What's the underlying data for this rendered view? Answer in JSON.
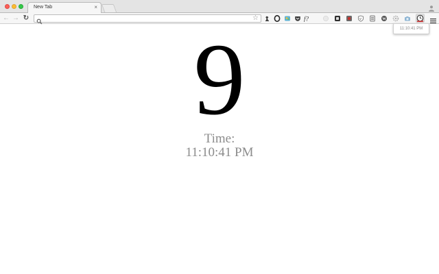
{
  "browser": {
    "tab": {
      "title": "New Tab",
      "close_glyph": "×"
    },
    "toolbar": {
      "back_icon": "arrow-left-icon",
      "forward_icon": "arrow-right-icon",
      "reload_icon": "reload-icon",
      "omnibox": {
        "value": "",
        "placeholder": "",
        "search_icon": "search-icon",
        "bookmark_icon": "star-icon"
      },
      "extensions": [
        "extension-chess-icon",
        "extension-opera-icon",
        "extension-puzzle-icon",
        "extension-pocket-icon",
        "extension-formula-icon",
        "extension-circle-icon",
        "extension-square-icon",
        "extension-lastpass-icon",
        "extension-shield-icon",
        "extension-document-icon",
        "extension-wordpress-icon",
        "extension-gear-icon",
        "extension-camera-icon",
        "extension-clock-icon"
      ],
      "menu_icon": "hamburger-menu-icon"
    },
    "popup": {
      "time": "11:10:41 PM"
    }
  },
  "page": {
    "digit": "9",
    "label": "Time:",
    "time": "11:10:41 PM"
  },
  "colors": {
    "tabstrip": "#e4e4e4",
    "toolbar": "#f6f6f6",
    "time_text": "#8c8c8c",
    "clock_extension_accent": "#d23b3b"
  }
}
